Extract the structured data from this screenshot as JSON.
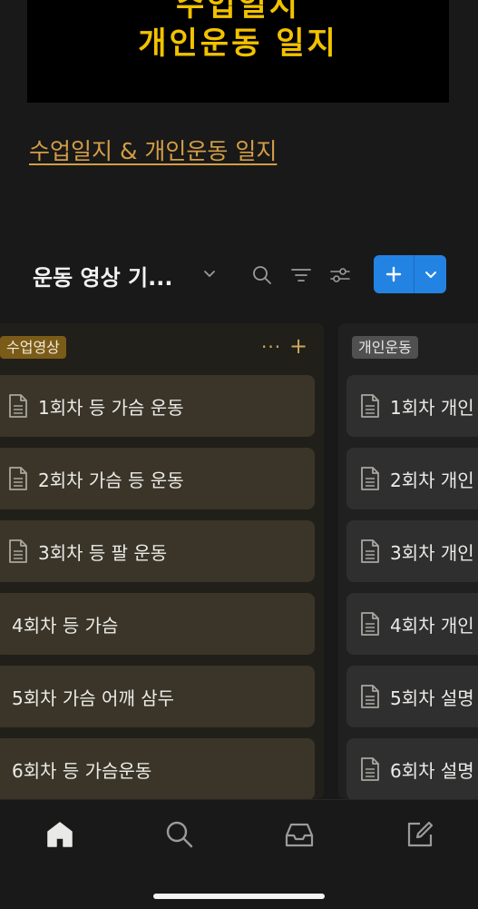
{
  "cover": {
    "line1": "수업일지",
    "line2": "개인운동 일지",
    "text_color": "#f2c200"
  },
  "page_link": "수업일지 & 개인운동 일지",
  "view": {
    "title": "운동 영상 기...",
    "icons": [
      "chevron-down-icon",
      "search-icon",
      "filter-icon",
      "settings-sliders-icon"
    ],
    "new_button_color": "#2383e2"
  },
  "columns": [
    {
      "tag": "수업영상",
      "tag_color": "#7a5b17",
      "more": "···",
      "add": "+",
      "cards": [
        {
          "title": "1회차 등 가슴 운동",
          "icon": "document-icon"
        },
        {
          "title": "2회차 가슴 등 운동",
          "icon": "document-icon"
        },
        {
          "title": "3회차 등 팔 운동",
          "icon": "document-icon"
        },
        {
          "title": "4회차 등 가슴",
          "icon": ""
        },
        {
          "title": "5회차 가슴 어깨 삼두",
          "icon": ""
        },
        {
          "title": "6회차 등 가슴운동",
          "icon": ""
        }
      ]
    },
    {
      "tag": "개인운동",
      "tag_color": "#505050",
      "cards": [
        {
          "title": "1회차 개인",
          "icon": "document-icon"
        },
        {
          "title": "2회차 개인",
          "icon": "document-icon"
        },
        {
          "title": "3회차 개인",
          "icon": "document-icon"
        },
        {
          "title": "4회차 개인",
          "icon": "document-icon"
        },
        {
          "title": "5회차 설명",
          "icon": "document-icon"
        },
        {
          "title": "6회차 설명",
          "icon": "document-icon"
        }
      ]
    }
  ],
  "bottom_nav": [
    "home-icon",
    "search-icon",
    "inbox-icon",
    "compose-icon"
  ]
}
